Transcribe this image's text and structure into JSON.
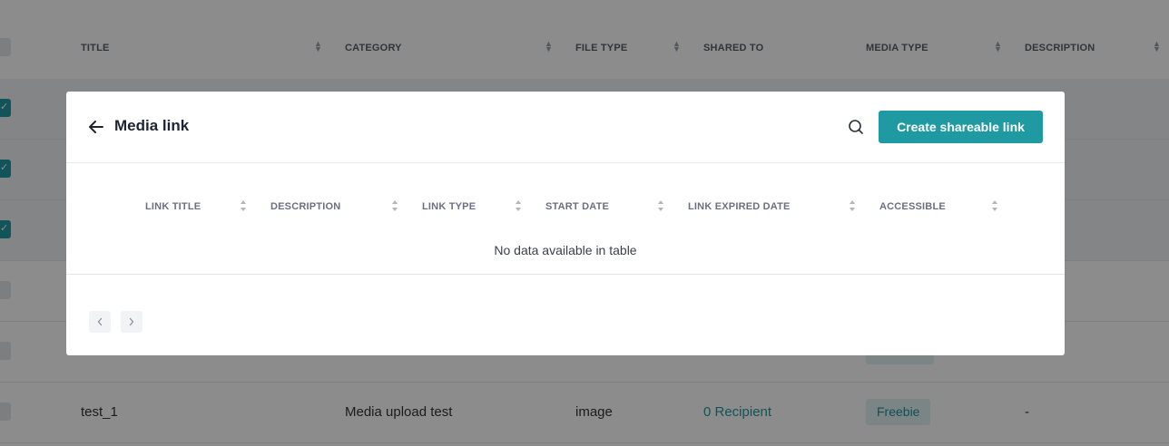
{
  "background_table": {
    "headers": [
      "TITLE",
      "CATEGORY",
      "FILE TYPE",
      "SHARED TO",
      "MEDIA TYPE",
      "DESCRIPTION"
    ],
    "last_row": {
      "title": "test_1",
      "category": "Media upload test",
      "file_type": "image",
      "shared_to": "0 Recipient",
      "media_type": "Freebie",
      "description": "-"
    }
  },
  "modal": {
    "title": "Media link",
    "create_button": "Create shareable link",
    "columns": [
      "LINK TITLE",
      "DESCRIPTION",
      "LINK TYPE",
      "START DATE",
      "LINK EXPIRED DATE",
      "ACCESSIBLE"
    ],
    "empty_message": "No data available in table",
    "pager_prev": "‹",
    "pager_next": "›"
  },
  "colors": {
    "accent": "#1f9aa3",
    "overlay": "rgba(0,0,0,0.45)"
  }
}
